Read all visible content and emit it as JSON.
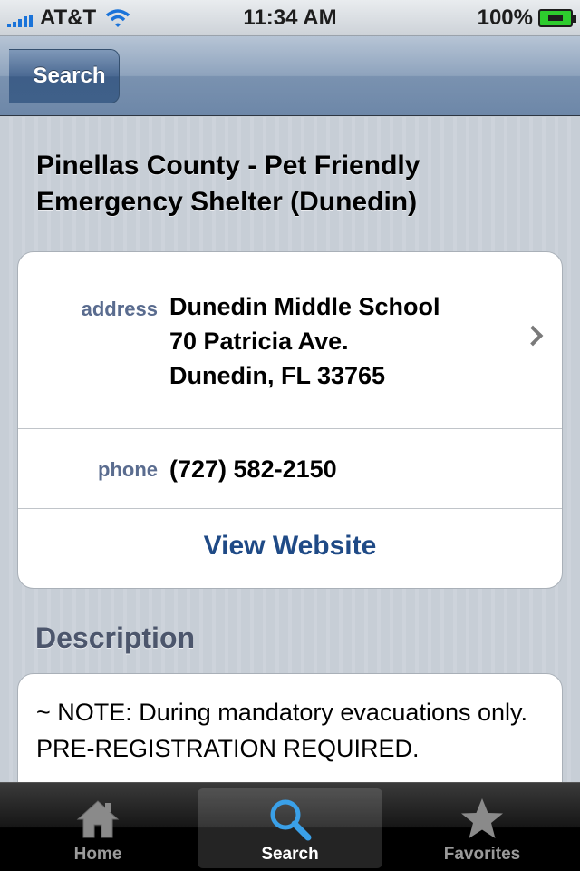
{
  "status_bar": {
    "carrier": "AT&T",
    "time": "11:34 AM",
    "battery": "100%",
    "signal_icon": "signal-bars-icon",
    "wifi_icon": "wifi-icon",
    "battery_icon": "battery-charging-icon"
  },
  "nav": {
    "back_label": "Search"
  },
  "detail": {
    "title": "Pinellas County - Pet Friendly Emergency Shelter (Dunedin)",
    "address_label": "address",
    "address_line1": "Dunedin Middle School",
    "address_line2": "70 Patricia Ave.",
    "address_line3": "Dunedin, FL 33765",
    "phone_label": "phone",
    "phone_value": "(727) 582-2150",
    "website_label": "View Website"
  },
  "description": {
    "header": "Description",
    "text": "~ NOTE: During mandatory evacuations only. PRE-REGISTRATION REQUIRED."
  },
  "tabs": [
    {
      "label": "Home",
      "icon": "home-icon",
      "active": false
    },
    {
      "label": "Search",
      "icon": "search-icon",
      "active": true
    },
    {
      "label": "Favorites",
      "icon": "star-icon",
      "active": false
    }
  ],
  "colors": {
    "nav_blue": "#6d87a8",
    "link_blue": "#1f4a86",
    "label_blue": "#5a6c8f",
    "search_icon_blue": "#3aa0e8"
  }
}
